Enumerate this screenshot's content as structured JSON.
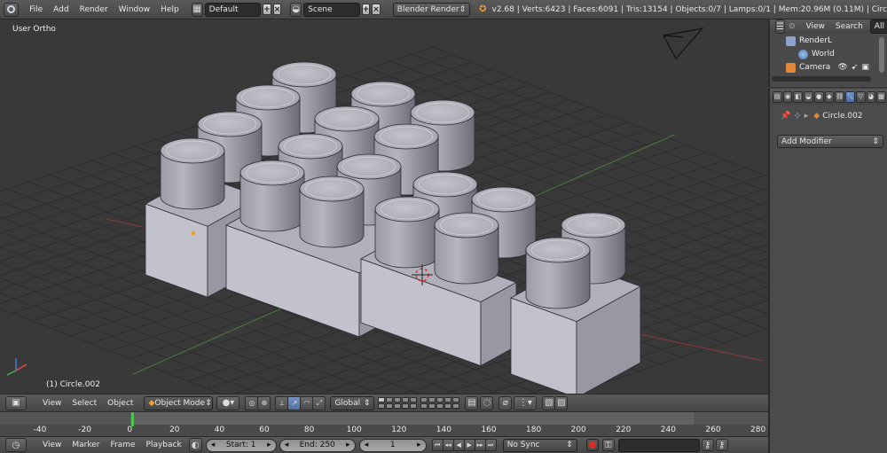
{
  "top_header": {
    "menus": [
      "File",
      "Add",
      "Render",
      "Window",
      "Help"
    ],
    "screen_layout": "Default",
    "scene": "Scene",
    "render_engine": "Blender Render",
    "stats": "v2.68 | Verts:6423 | Faces:6091 | Tris:13154 | Objects:0/7 | Lamps:0/1 | Mem:20.96M (0.11M) | Circ"
  },
  "viewport": {
    "view_name": "User Ortho",
    "object_info": "(1) Circle.002"
  },
  "view_header": {
    "menus": [
      "View",
      "Select",
      "Object"
    ],
    "mode": "Object Mode",
    "orientation": "Global"
  },
  "timeline": {
    "ticks": [
      "-40",
      "-20",
      "0",
      "20",
      "40",
      "60",
      "80",
      "100",
      "120",
      "140",
      "160",
      "180",
      "200",
      "220",
      "240",
      "260",
      "280"
    ]
  },
  "playback": {
    "menus": [
      "View",
      "Marker",
      "Frame",
      "Playback"
    ],
    "start": "Start: 1",
    "end": "End: 250",
    "current_frame": "1",
    "sync": "No Sync"
  },
  "outliner": {
    "menus": [
      "View",
      "Search",
      "All"
    ],
    "items": [
      "RenderL",
      "World",
      "Camera"
    ]
  },
  "properties": {
    "object_name": "Circle.002",
    "add_modifier": "Add Modifier"
  },
  "colors": {
    "accent_active": "#5c7cb4",
    "frame_cursor": "#4fc24f",
    "selection_origin": "#f0a030"
  }
}
